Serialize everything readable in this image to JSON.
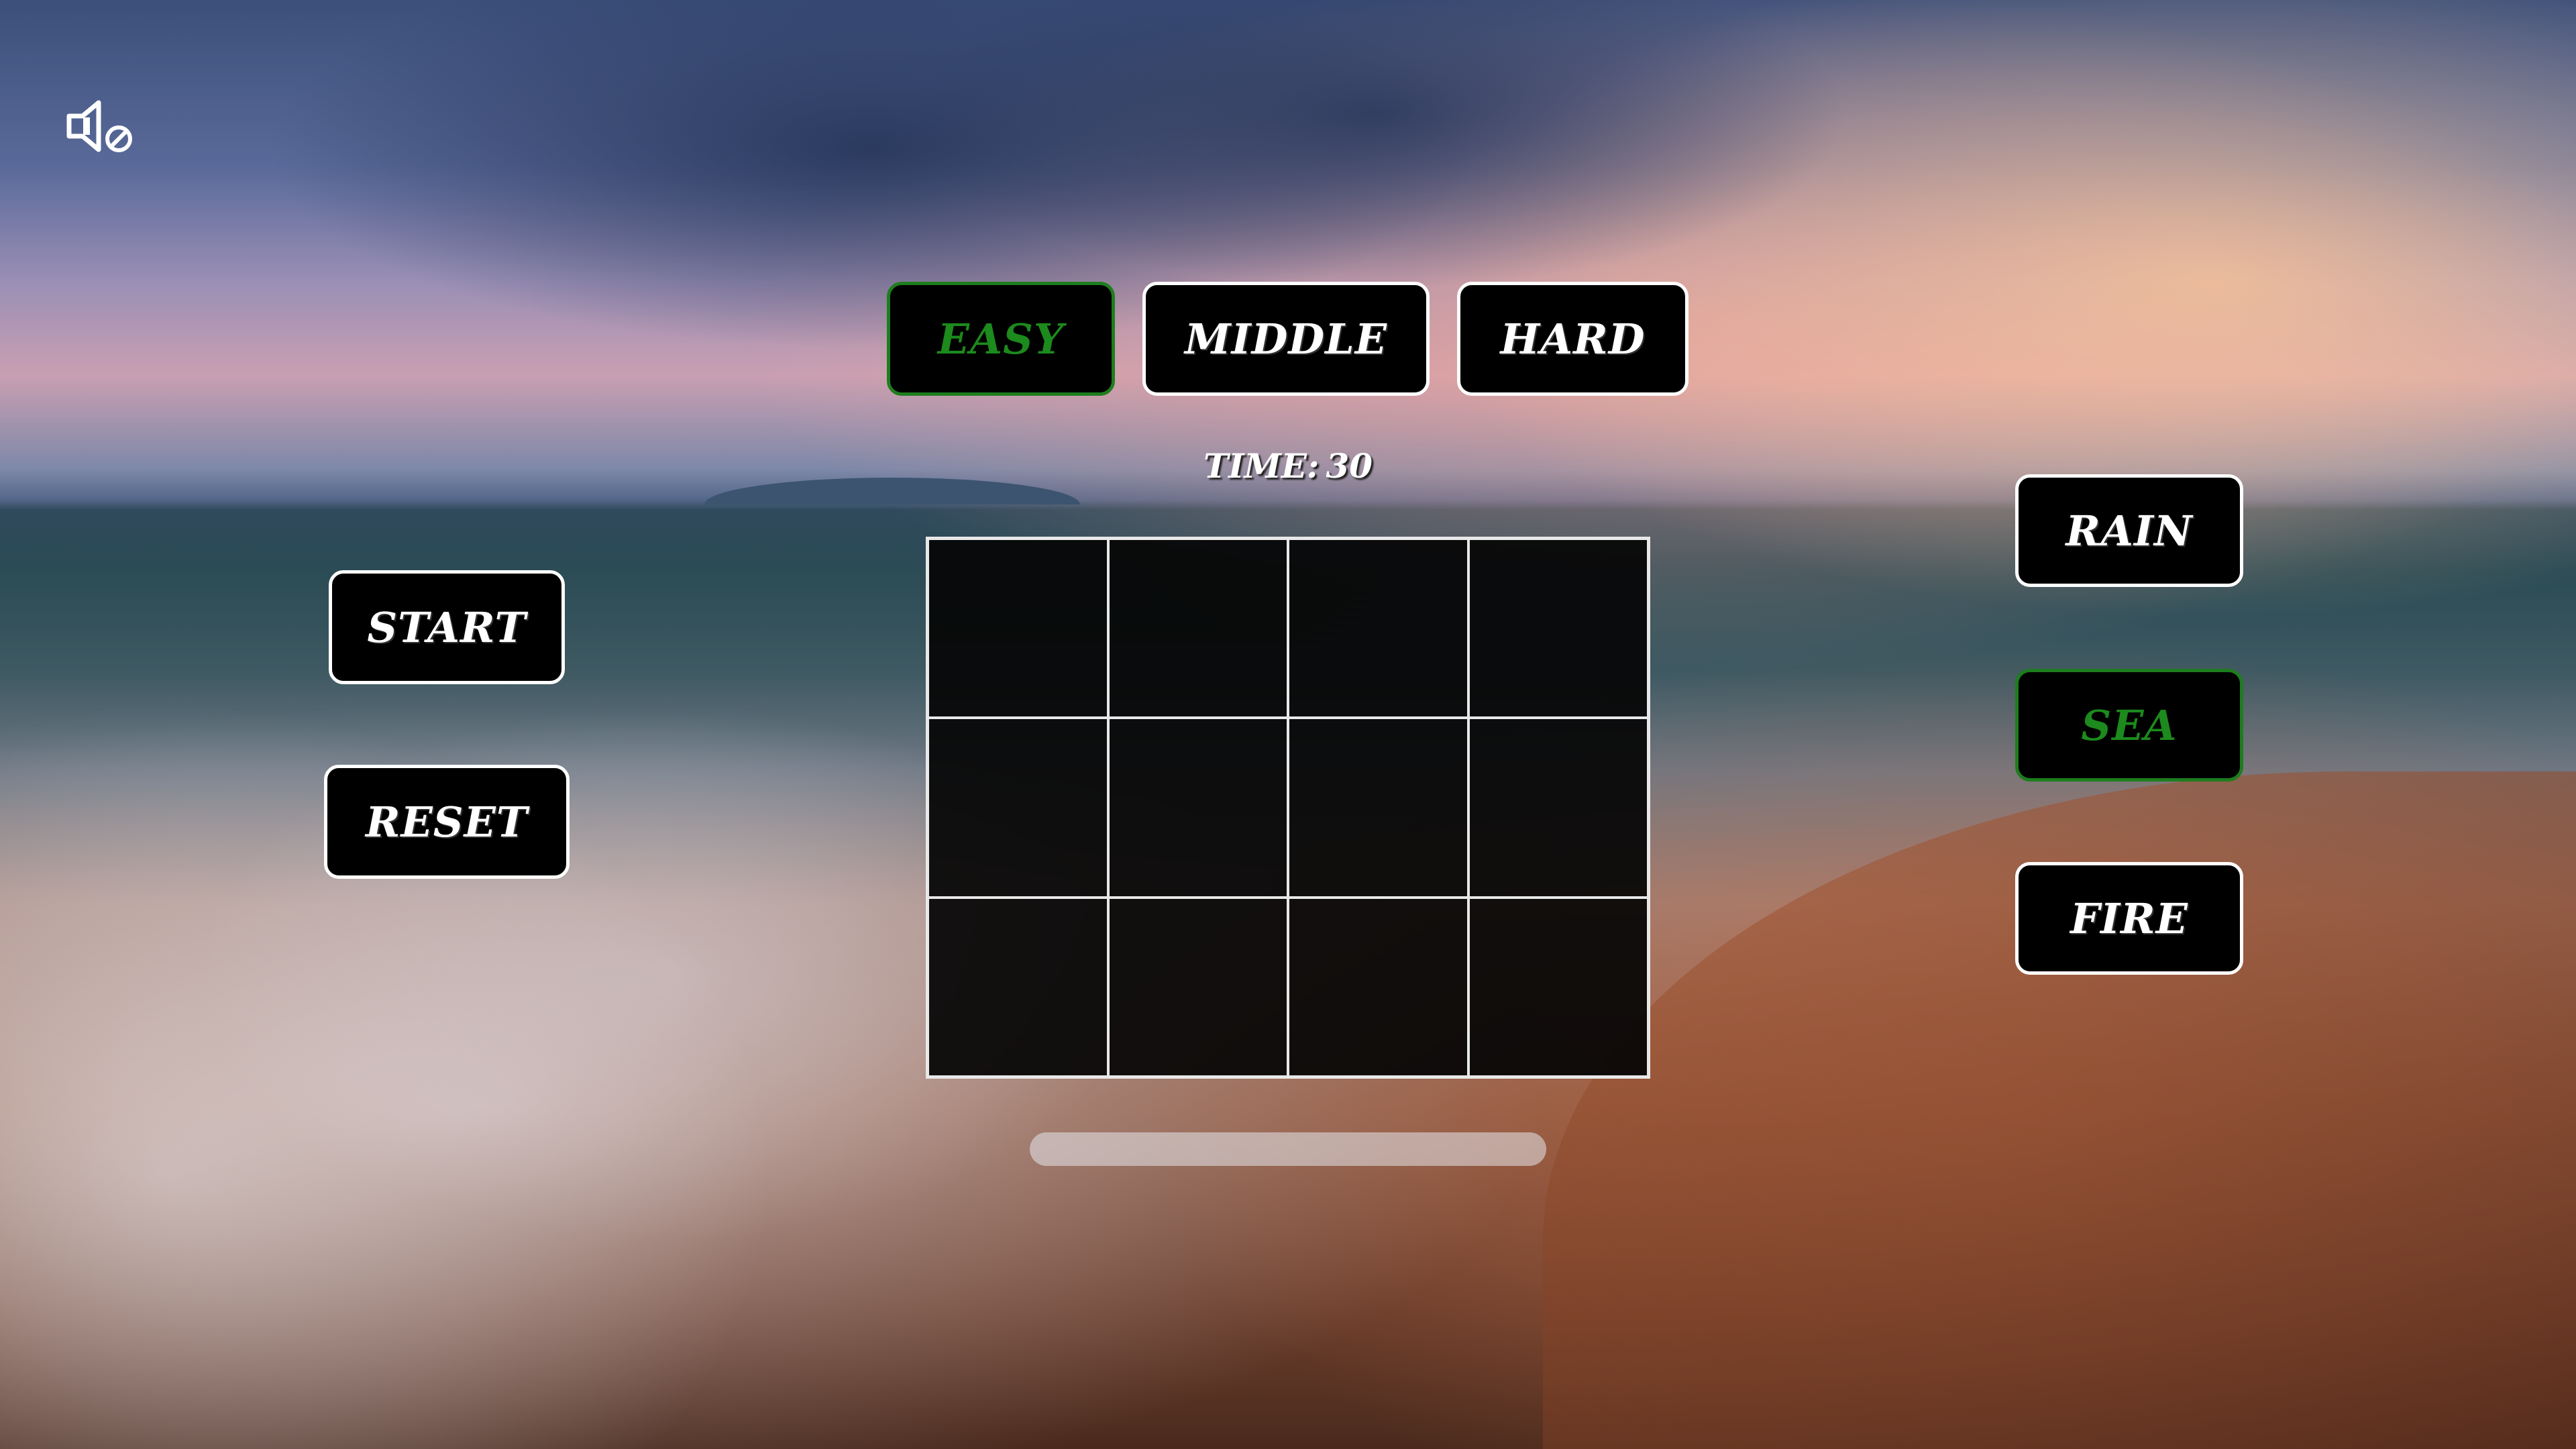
{
  "sound": {
    "icon": "speaker-muted-icon",
    "muted": true
  },
  "difficulty": {
    "options": [
      {
        "label": "EASY",
        "active": true
      },
      {
        "label": "MIDDLE",
        "active": false
      },
      {
        "label": "HARD",
        "active": false
      }
    ]
  },
  "timer": {
    "label": "TIME:",
    "value": "30"
  },
  "controls": {
    "start_label": "START",
    "reset_label": "RESET"
  },
  "themes": {
    "options": [
      {
        "label": "RAIN",
        "active": false
      },
      {
        "label": "SEA",
        "active": true
      },
      {
        "label": "FIRE",
        "active": false
      }
    ]
  },
  "board": {
    "columns": 4,
    "rows": 3,
    "tiles": 12
  },
  "progress": {
    "fraction": 0
  },
  "colors": {
    "button_bg": "#000000",
    "button_border": "#ffffff",
    "active_accent": "#1c8a1c",
    "text": "#ffffff"
  }
}
